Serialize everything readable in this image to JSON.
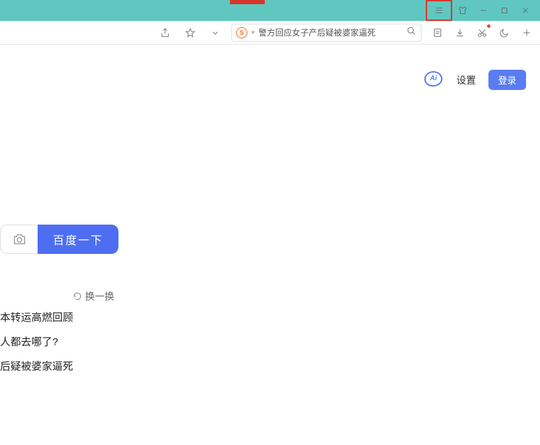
{
  "titlebar": {
    "menu": "menu",
    "pin": "pin",
    "min": "minimize",
    "max": "maximize",
    "close": "close"
  },
  "toolbar": {
    "share": "share",
    "star": "favorite",
    "dropdown": "▾",
    "engine": "S",
    "address": "警方回应女子产后疑被婆家逼死",
    "search": "search",
    "read": "read-mode",
    "download": "download",
    "snip": "screenshot",
    "night": "night-mode",
    "add": "+"
  },
  "subheader": {
    "ai": "Ai",
    "settings": "设置",
    "login": "登录"
  },
  "search": {
    "camera": "camera",
    "button": "百度一下"
  },
  "refresh": {
    "label": "换一换"
  },
  "news": {
    "items": [
      "本转运高燃回顾",
      "人都去哪了?",
      "后疑被婆家逼死"
    ]
  }
}
